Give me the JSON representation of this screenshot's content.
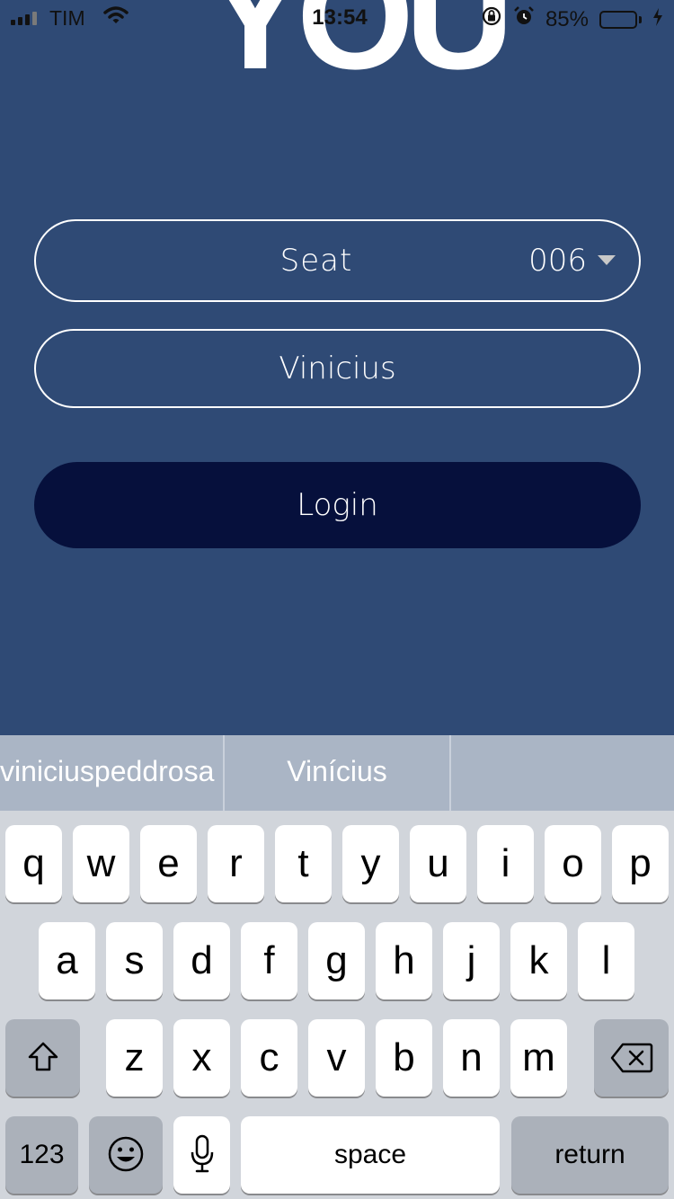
{
  "status_bar": {
    "carrier": "TIM",
    "time": "13:54",
    "battery_percent_text": "85%",
    "battery_level": 0.85,
    "icons": [
      "signal-icon",
      "wifi-icon",
      "orientation-lock-icon",
      "alarm-icon",
      "battery-icon",
      "charging-icon"
    ]
  },
  "app": {
    "logo_text": "YOU",
    "seat_field": {
      "label": "Seat",
      "value": "006"
    },
    "name_field": {
      "value": "Vinicius"
    },
    "login_button": {
      "label": "Login"
    }
  },
  "keyboard": {
    "suggestions": [
      "viniciuspeddrosa",
      "Vinícius",
      ""
    ],
    "row1": [
      "q",
      "w",
      "e",
      "r",
      "t",
      "y",
      "u",
      "i",
      "o",
      "p"
    ],
    "row2": [
      "a",
      "s",
      "d",
      "f",
      "g",
      "h",
      "j",
      "k",
      "l"
    ],
    "row3": [
      "z",
      "x",
      "c",
      "v",
      "b",
      "n",
      "m"
    ],
    "numbers_key": "123",
    "space_key": "space",
    "return_key": "return"
  },
  "colors": {
    "background": "#2f4a75",
    "login_button": "#06103c",
    "suggestion_bar": "#aab5c5",
    "keyboard": "#d1d5db"
  }
}
